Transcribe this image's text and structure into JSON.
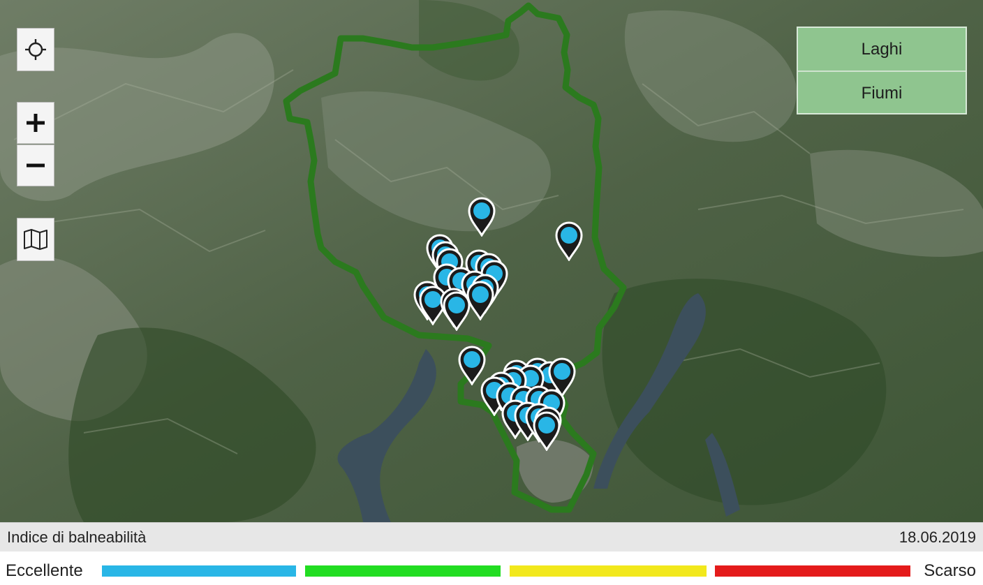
{
  "map": {
    "controls": {
      "locate_icon": "crosshair-icon",
      "zoom_in_icon": "plus-icon",
      "zoom_out_icon": "minus-icon",
      "layers_icon": "map-icon"
    },
    "marker_color": "#29b6e6",
    "border_color": "#2b7a1e"
  },
  "panel": {
    "lakes_label": "Laghi",
    "rivers_label": "Fiumi",
    "button_color": "#8fc58f"
  },
  "info_bar": {
    "title": "Indice di balneabilità",
    "date": "18.06.2019"
  },
  "legend": {
    "high_label": "Eccellente",
    "low_label": "Scarso",
    "colors": [
      "#29b6e6",
      "#22dd22",
      "#f2e81c",
      "#e41b1b"
    ]
  }
}
